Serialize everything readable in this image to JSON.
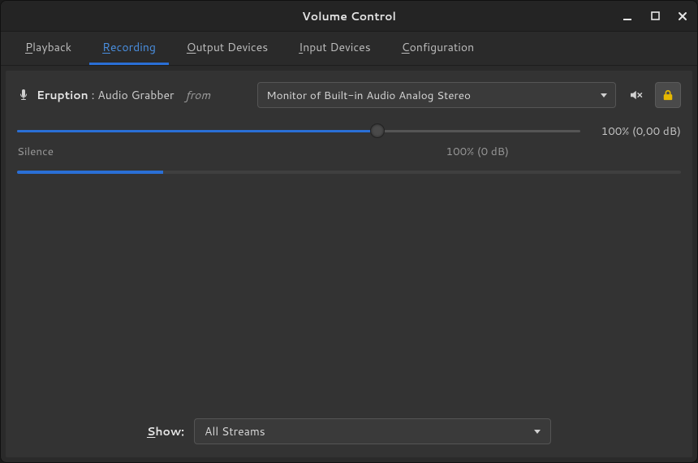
{
  "window": {
    "title": "Volume Control"
  },
  "tabs": [
    {
      "label": "Playback",
      "mnemonic": "P",
      "rest": "layback",
      "active": false
    },
    {
      "label": "Recording",
      "mnemonic": "R",
      "rest": "ecording",
      "active": true
    },
    {
      "label": "Output Devices",
      "mnemonic": "O",
      "rest": "utput Devices",
      "active": false
    },
    {
      "label": "Input Devices",
      "mnemonic": "I",
      "rest": "nput Devices",
      "active": false
    },
    {
      "label": "Configuration",
      "mnemonic": "C",
      "rest": "onfiguration",
      "active": false
    }
  ],
  "stream": {
    "app_name": "Eruption",
    "separator": " : ",
    "description": "Audio Grabber",
    "from_label": "from",
    "device_selected": "Monitor of Built-in Audio Analog Stereo",
    "mute_icon": "volume-muted-icon",
    "lock_icon": "lock-icon",
    "locked": true,
    "volume_percent": 100,
    "volume_display": "100% (0,00 dB)",
    "scale_min_label": "Silence",
    "scale_ref_label": "100% (0 dB)",
    "level_meter_percent": 22
  },
  "footer": {
    "label": "Show:",
    "mnemonic": "S",
    "rest": "how:",
    "selected": "All Streams"
  },
  "colors": {
    "accent": "#2a6fd6",
    "lock": "#e6b800",
    "bg": "#333333"
  }
}
